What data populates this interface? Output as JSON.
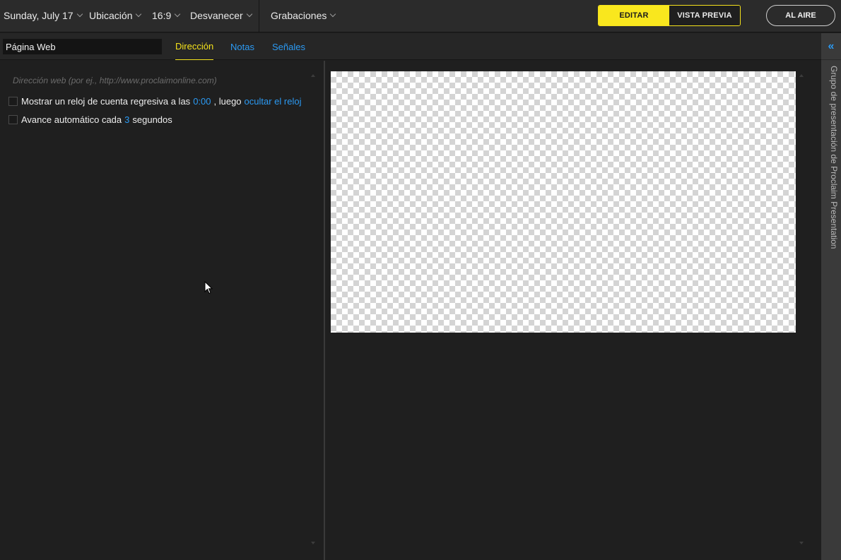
{
  "topbar": {
    "date": "Sunday, July 17",
    "location": "Ubicación",
    "aspect": "16:9",
    "transition": "Desvanecer",
    "recordings": "Grabaciones",
    "mode": {
      "edit": "EDITAR",
      "preview": "VISTA PREVIA",
      "active": "edit"
    },
    "on_air": "AL AIRE"
  },
  "slide": {
    "title_value": "Página Web"
  },
  "tabs": [
    {
      "label": "Dirección",
      "active": true
    },
    {
      "label": "Notas",
      "active": false
    },
    {
      "label": "Señales",
      "active": false
    }
  ],
  "web": {
    "url_placeholder": "Dirección web (por ej., http://www.proclaimonline.com)",
    "url_value": "",
    "countdown": {
      "checked": false,
      "text_before": "Mostrar un reloj de cuenta regresiva a las",
      "time": "0:00",
      "text_middle": ", luego",
      "action": "ocultar el reloj"
    },
    "autoadvance": {
      "checked": false,
      "text_before": "Avance automático cada",
      "seconds": "3",
      "text_after": "segundos"
    }
  },
  "sidebar": {
    "collapse_icon": "double-chevron-left-icon",
    "label": "Grupo de presentación de Proclaim Presentation"
  },
  "colors": {
    "accent_yellow": "#f9e71e",
    "link_blue": "#2b9af3",
    "background": "#1f1f1f"
  }
}
